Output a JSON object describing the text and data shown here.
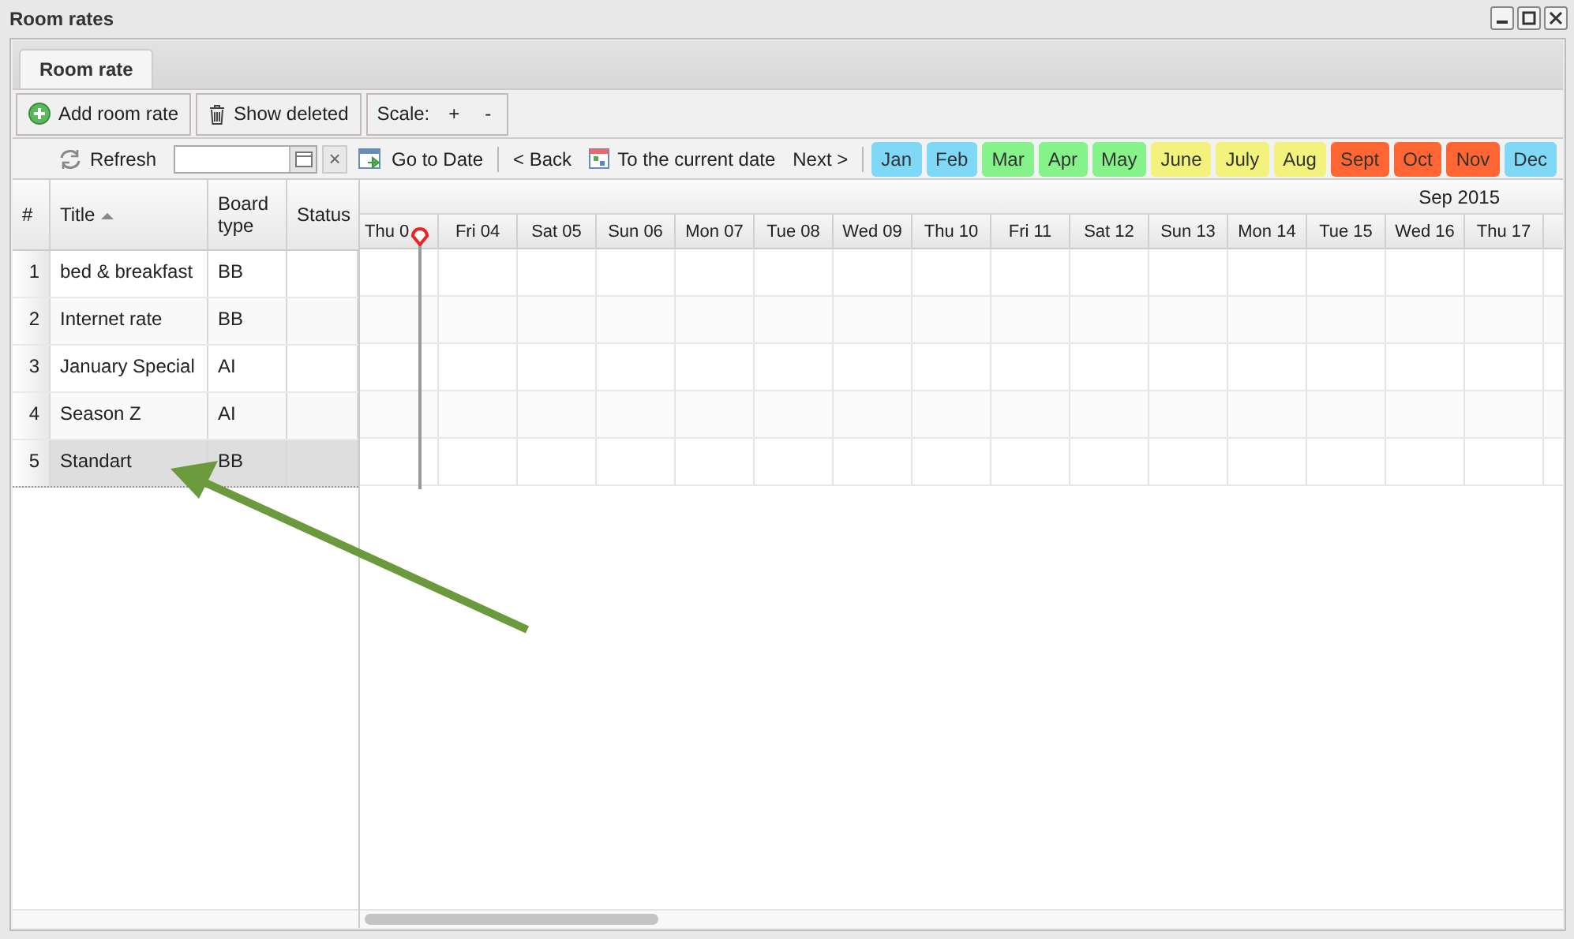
{
  "window": {
    "title": "Room rates"
  },
  "tabs": [
    {
      "label": "Room rate",
      "selected": true
    }
  ],
  "toolbar": {
    "add": "Add room rate",
    "deleted": "Show deleted",
    "scale_label": "Scale:",
    "scale_plus": "+",
    "scale_minus": "-"
  },
  "nav": {
    "refresh": "Refresh",
    "clear": "×",
    "goto": "Go to Date",
    "back": "< Back",
    "current": "To the current date",
    "next": "Next >"
  },
  "months": [
    {
      "label": "Jan",
      "color": "#80d8f7"
    },
    {
      "label": "Feb",
      "color": "#80d8f7"
    },
    {
      "label": "Mar",
      "color": "#86f28a"
    },
    {
      "label": "Apr",
      "color": "#86f28a"
    },
    {
      "label": "May",
      "color": "#86f28a"
    },
    {
      "label": "June",
      "color": "#f2f27c"
    },
    {
      "label": "July",
      "color": "#f2f27c"
    },
    {
      "label": "Aug",
      "color": "#f2f27c"
    },
    {
      "label": "Sept",
      "color": "#ff6633"
    },
    {
      "label": "Oct",
      "color": "#ff6633"
    },
    {
      "label": "Nov",
      "color": "#ff6633"
    },
    {
      "label": "Dec",
      "color": "#80d8f7"
    }
  ],
  "grid": {
    "columns": [
      {
        "label": "#",
        "sorted": false
      },
      {
        "label": "Title",
        "sorted": true
      },
      {
        "label": "Board type",
        "sorted": false
      },
      {
        "label": "Status",
        "sorted": false
      }
    ],
    "rows": [
      {
        "number": "1",
        "title": "bed & breakfast",
        "board": "BB",
        "selected": false
      },
      {
        "number": "2",
        "title": "Internet rate",
        "board": "BB",
        "selected": false
      },
      {
        "number": "3",
        "title": "January Special",
        "board": "AI",
        "selected": false
      },
      {
        "number": "4",
        "title": "Season Z",
        "board": "AI",
        "selected": false
      },
      {
        "number": "5",
        "title": "Standart",
        "board": "BB",
        "selected": true
      }
    ]
  },
  "schedule": {
    "month": "Sep 2015",
    "days": [
      "Thu 0",
      "Fri 04",
      "Sat 05",
      "Sun 06",
      "Mon 07",
      "Tue 08",
      "Wed 09",
      "Thu 10",
      "Fri 11",
      "Sat 12",
      "Sun 13",
      "Mon 14",
      "Tue 15",
      "Wed 16",
      "Thu 17"
    ]
  }
}
